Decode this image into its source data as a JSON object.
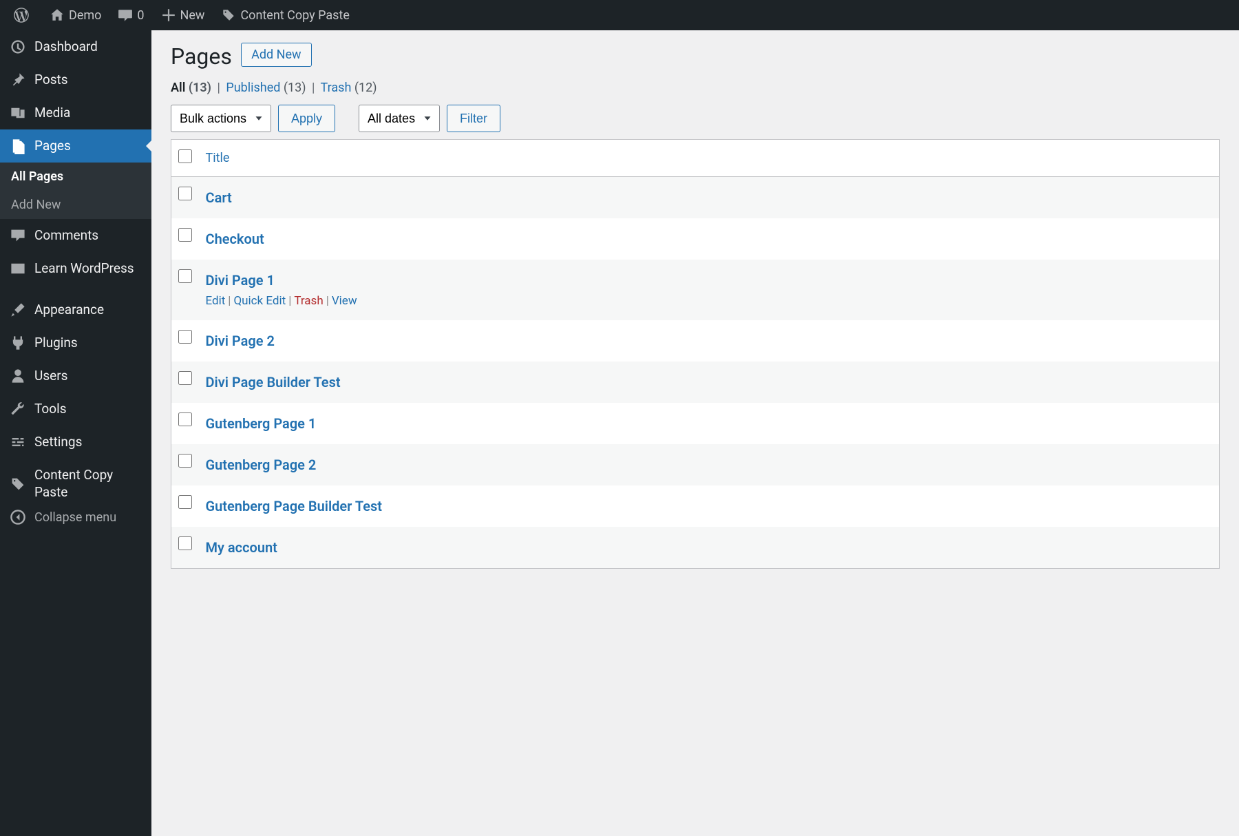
{
  "adminbar": {
    "site_name": "Demo",
    "comments_count": "0",
    "new_label": "New",
    "plugin_link": "Content Copy Paste"
  },
  "sidebar": {
    "items": [
      {
        "id": "dashboard",
        "label": "Dashboard",
        "icon": "dashboard"
      },
      {
        "id": "posts",
        "label": "Posts",
        "icon": "pin"
      },
      {
        "id": "media",
        "label": "Media",
        "icon": "media"
      },
      {
        "id": "pages",
        "label": "Pages",
        "icon": "pages",
        "current": true,
        "submenu": [
          {
            "label": "All Pages",
            "current": true
          },
          {
            "label": "Add New"
          }
        ]
      },
      {
        "id": "comments",
        "label": "Comments",
        "icon": "comment"
      },
      {
        "id": "learn",
        "label": "Learn WordPress",
        "icon": "video"
      },
      {
        "sep": true
      },
      {
        "id": "appearance",
        "label": "Appearance",
        "icon": "brush"
      },
      {
        "id": "plugins",
        "label": "Plugins",
        "icon": "plug"
      },
      {
        "id": "users",
        "label": "Users",
        "icon": "user"
      },
      {
        "id": "tools",
        "label": "Tools",
        "icon": "wrench"
      },
      {
        "id": "settings",
        "label": "Settings",
        "icon": "sliders"
      },
      {
        "sep": true
      },
      {
        "id": "ccp",
        "label": "Content Copy Paste",
        "icon": "tags"
      }
    ],
    "collapse_label": "Collapse menu"
  },
  "page": {
    "heading": "Pages",
    "add_new": "Add New",
    "filters": {
      "all": {
        "label": "All",
        "count": "(13)"
      },
      "published": {
        "label": "Published",
        "count": "(13)"
      },
      "trash": {
        "label": "Trash",
        "count": "(12)"
      }
    },
    "bulk_select": "Bulk actions",
    "apply_label": "Apply",
    "date_select": "All dates",
    "filter_label": "Filter",
    "table": {
      "title_col": "Title",
      "rows": [
        {
          "title": "Cart"
        },
        {
          "title": "Checkout"
        },
        {
          "title": "Divi Page 1",
          "show_actions": true
        },
        {
          "title": "Divi Page 2"
        },
        {
          "title": "Divi Page Builder Test"
        },
        {
          "title": "Gutenberg Page 1"
        },
        {
          "title": "Gutenberg Page 2"
        },
        {
          "title": "Gutenberg Page Builder Test"
        },
        {
          "title": "My account"
        }
      ],
      "actions": {
        "edit": "Edit",
        "quick_edit": "Quick Edit",
        "trash": "Trash",
        "view": "View"
      }
    }
  }
}
